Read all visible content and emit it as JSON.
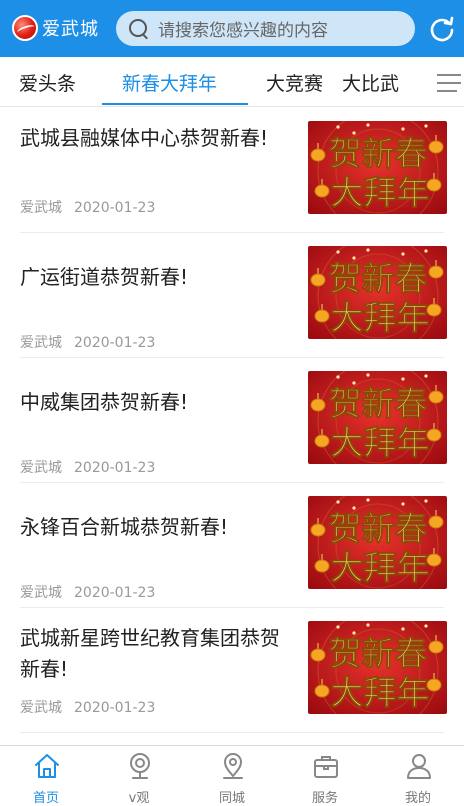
{
  "header": {
    "logo_text": "爱武城",
    "search_placeholder": "请搜索您感兴趣的内容",
    "brand_color": "#1e8fe6"
  },
  "tabs": [
    {
      "label": "爱头条",
      "active": false
    },
    {
      "label": "新春大拜年",
      "active": true
    },
    {
      "label": "大竞赛",
      "active": false
    },
    {
      "label": "大比武",
      "active": false
    }
  ],
  "articles": [
    {
      "title": "武城县融媒体中心恭贺新春!",
      "source": "爱武城",
      "date": "2020-01-23"
    },
    {
      "title": "广运街道恭贺新春!",
      "source": "爱武城",
      "date": "2020-01-23"
    },
    {
      "title": "中威集团恭贺新春!",
      "source": "爱武城",
      "date": "2020-01-23"
    },
    {
      "title": "永锋百合新城恭贺新春!",
      "source": "爱武城",
      "date": "2020-01-23"
    },
    {
      "title": "武城新星跨世纪教育集团恭贺新春!",
      "source": "爱武城",
      "date": "2020-01-23"
    }
  ],
  "thumbnail": {
    "line1": "贺新春",
    "line2": "大拜年",
    "bg_color": "#c8141a",
    "text_color": "#f6d36a"
  },
  "bottom_nav": [
    {
      "label": "首页",
      "icon": "home-icon",
      "active": true
    },
    {
      "label": "v观",
      "icon": "camera-icon",
      "active": false
    },
    {
      "label": "同城",
      "icon": "location-pin-icon",
      "active": false
    },
    {
      "label": "服务",
      "icon": "briefcase-icon",
      "active": false
    },
    {
      "label": "我的",
      "icon": "user-icon",
      "active": false
    }
  ]
}
